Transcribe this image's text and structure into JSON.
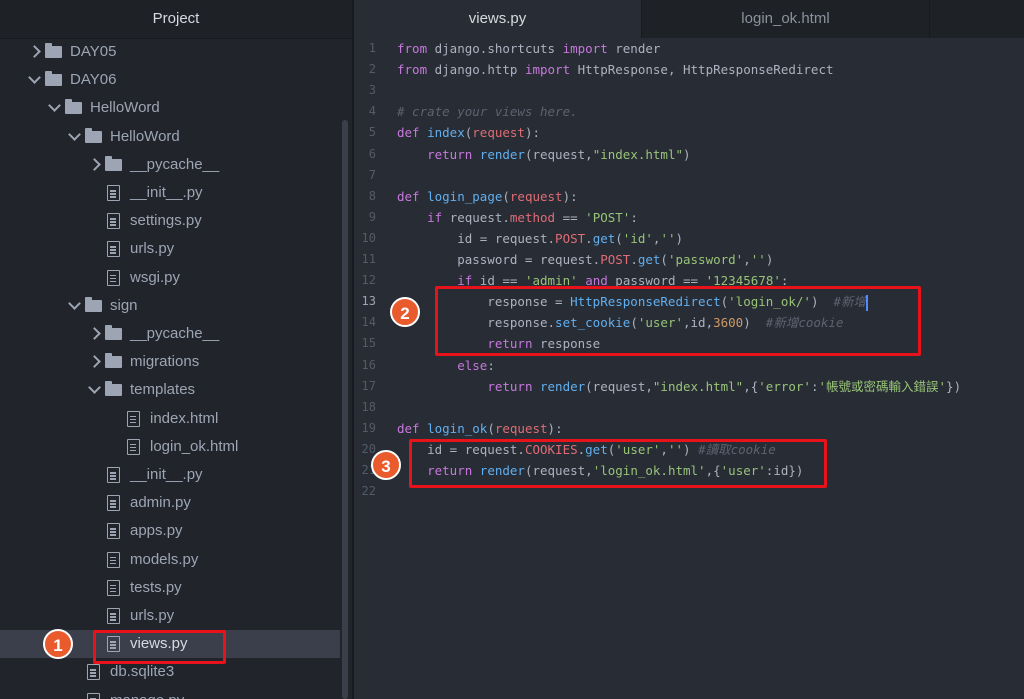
{
  "sidebar": {
    "title": "Project",
    "items": [
      {
        "label": "DAY05",
        "kind": "folder",
        "expanded": false,
        "depth": 0
      },
      {
        "label": "DAY06",
        "kind": "folder",
        "expanded": true,
        "depth": 0
      },
      {
        "label": "HelloWord",
        "kind": "folder",
        "expanded": true,
        "depth": 1
      },
      {
        "label": "HelloWord",
        "kind": "folder",
        "expanded": true,
        "depth": 2
      },
      {
        "label": "__pycache__",
        "kind": "folder",
        "expanded": false,
        "depth": 3
      },
      {
        "label": "__init__.py",
        "kind": "file",
        "depth": 3
      },
      {
        "label": "settings.py",
        "kind": "file",
        "depth": 3
      },
      {
        "label": "urls.py",
        "kind": "file",
        "depth": 3
      },
      {
        "label": "wsgi.py",
        "kind": "file",
        "depth": 3
      },
      {
        "label": "sign",
        "kind": "folder",
        "expanded": true,
        "depth": 2
      },
      {
        "label": "__pycache__",
        "kind": "folder",
        "expanded": false,
        "depth": 3
      },
      {
        "label": "migrations",
        "kind": "folder",
        "expanded": false,
        "depth": 3
      },
      {
        "label": "templates",
        "kind": "folder",
        "expanded": true,
        "depth": 3
      },
      {
        "label": "index.html",
        "kind": "file",
        "depth": 4
      },
      {
        "label": "login_ok.html",
        "kind": "file",
        "depth": 4
      },
      {
        "label": "__init__.py",
        "kind": "file",
        "depth": 3
      },
      {
        "label": "admin.py",
        "kind": "file",
        "depth": 3
      },
      {
        "label": "apps.py",
        "kind": "file",
        "depth": 3
      },
      {
        "label": "models.py",
        "kind": "file",
        "depth": 3
      },
      {
        "label": "tests.py",
        "kind": "file",
        "depth": 3
      },
      {
        "label": "urls.py",
        "kind": "file",
        "depth": 3
      },
      {
        "label": "views.py",
        "kind": "file",
        "depth": 3,
        "selected": true
      },
      {
        "label": "db.sqlite3",
        "kind": "file",
        "depth": 2
      },
      {
        "label": "manage.py",
        "kind": "file",
        "depth": 2
      }
    ]
  },
  "tabs": [
    {
      "label": "views.py",
      "active": true
    },
    {
      "label": "login_ok.html",
      "active": false
    }
  ],
  "editor": {
    "current_line": 13,
    "lines": [
      [
        [
          "kw",
          "from"
        ],
        [
          "t",
          " django.shortcuts "
        ],
        [
          "kw",
          "import"
        ],
        [
          "t",
          " render"
        ]
      ],
      [
        [
          "kw",
          "from"
        ],
        [
          "t",
          " django.http "
        ],
        [
          "kw",
          "import"
        ],
        [
          "t",
          " HttpResponse, HttpResponseRedirect"
        ]
      ],
      [],
      [
        [
          "cm",
          "# crate your views here."
        ]
      ],
      [
        [
          "kw",
          "def"
        ],
        [
          "t",
          " "
        ],
        [
          "fn",
          "index"
        ],
        [
          "t",
          "("
        ],
        [
          "red",
          "request"
        ],
        [
          "t",
          "):"
        ]
      ],
      [
        [
          "t",
          "    "
        ],
        [
          "kw",
          "return"
        ],
        [
          "t",
          " "
        ],
        [
          "fn",
          "render"
        ],
        [
          "t",
          "(request,"
        ],
        [
          "str",
          "\"index.html\""
        ],
        [
          "t",
          ")"
        ]
      ],
      [],
      [
        [
          "kw",
          "def"
        ],
        [
          "t",
          " "
        ],
        [
          "fn",
          "login_page"
        ],
        [
          "t",
          "("
        ],
        [
          "red",
          "request"
        ],
        [
          "t",
          "):"
        ]
      ],
      [
        [
          "t",
          "    "
        ],
        [
          "kw",
          "if"
        ],
        [
          "t",
          " request."
        ],
        [
          "red",
          "method"
        ],
        [
          "t",
          " == "
        ],
        [
          "str",
          "'POST'"
        ],
        [
          "t",
          ":"
        ]
      ],
      [
        [
          "t",
          "        id = request."
        ],
        [
          "red",
          "POST"
        ],
        [
          "t",
          "."
        ],
        [
          "fn",
          "get"
        ],
        [
          "t",
          "("
        ],
        [
          "str",
          "'id'"
        ],
        [
          "t",
          ","
        ],
        [
          "str",
          "''"
        ],
        [
          "t",
          ")"
        ]
      ],
      [
        [
          "t",
          "        password = request."
        ],
        [
          "red",
          "POST"
        ],
        [
          "t",
          "."
        ],
        [
          "fn",
          "get"
        ],
        [
          "t",
          "("
        ],
        [
          "str",
          "'password'"
        ],
        [
          "t",
          ","
        ],
        [
          "str",
          "''"
        ],
        [
          "t",
          ")"
        ]
      ],
      [
        [
          "t",
          "        "
        ],
        [
          "kw",
          "if"
        ],
        [
          "t",
          " id == "
        ],
        [
          "str",
          "'admin'"
        ],
        [
          "t",
          " "
        ],
        [
          "kw",
          "and"
        ],
        [
          "t",
          " password == "
        ],
        [
          "str",
          "'12345678'"
        ],
        [
          "t",
          ":"
        ]
      ],
      [
        [
          "t",
          "            response = "
        ],
        [
          "fn",
          "HttpResponseRedirect"
        ],
        [
          "t",
          "("
        ],
        [
          "str",
          "'login_ok/'"
        ],
        [
          "t",
          ")  "
        ],
        [
          "cm",
          "#新增"
        ],
        [
          "cursor",
          ""
        ]
      ],
      [
        [
          "t",
          "            response."
        ],
        [
          "fn",
          "set_cookie"
        ],
        [
          "t",
          "("
        ],
        [
          "str",
          "'user'"
        ],
        [
          "t",
          ",id,"
        ],
        [
          "num",
          "3600"
        ],
        [
          "t",
          ")  "
        ],
        [
          "cm",
          "#新增cookie"
        ]
      ],
      [
        [
          "t",
          "            "
        ],
        [
          "kw",
          "return"
        ],
        [
          "t",
          " response"
        ]
      ],
      [
        [
          "t",
          "        "
        ],
        [
          "kw",
          "else"
        ],
        [
          "t",
          ":"
        ]
      ],
      [
        [
          "t",
          "            "
        ],
        [
          "kw",
          "return"
        ],
        [
          "t",
          " "
        ],
        [
          "fn",
          "render"
        ],
        [
          "t",
          "(request,"
        ],
        [
          "str",
          "\"index.html\""
        ],
        [
          "t",
          ",{"
        ],
        [
          "str",
          "'error'"
        ],
        [
          "t",
          ":"
        ],
        [
          "str",
          "'帳號或密碼輸入錯誤'"
        ],
        [
          "t",
          "})"
        ]
      ],
      [],
      [
        [
          "kw",
          "def"
        ],
        [
          "t",
          " "
        ],
        [
          "fn",
          "login_ok"
        ],
        [
          "t",
          "("
        ],
        [
          "red",
          "request"
        ],
        [
          "t",
          "):"
        ]
      ],
      [
        [
          "t",
          "    id = request."
        ],
        [
          "red",
          "COOKIES"
        ],
        [
          "t",
          "."
        ],
        [
          "fn",
          "get"
        ],
        [
          "t",
          "("
        ],
        [
          "str",
          "'user'"
        ],
        [
          "t",
          ","
        ],
        [
          "str",
          "''"
        ],
        [
          "t",
          ") "
        ],
        [
          "cm",
          "#讀取cookie"
        ]
      ],
      [
        [
          "t",
          "    "
        ],
        [
          "kw",
          "return"
        ],
        [
          "t",
          " "
        ],
        [
          "fn",
          "render"
        ],
        [
          "t",
          "(request,"
        ],
        [
          "str",
          "'login_ok.html'"
        ],
        [
          "t",
          ",{"
        ],
        [
          "str",
          "'user'"
        ],
        [
          "t",
          ":id})"
        ]
      ],
      []
    ]
  },
  "annotations": [
    {
      "label": "1",
      "target": "views.py"
    },
    {
      "label": "2",
      "target": "lines 13-15"
    },
    {
      "label": "3",
      "target": "lines 20-21"
    }
  ],
  "colors": {
    "annotation_box": "#e8121b",
    "annotation_badge": "#e95a2c",
    "keyword": "#c678dd",
    "function": "#61afef",
    "string": "#98c379",
    "number": "#d19a66",
    "attribute": "#e06c75",
    "comment": "#5c6370"
  }
}
